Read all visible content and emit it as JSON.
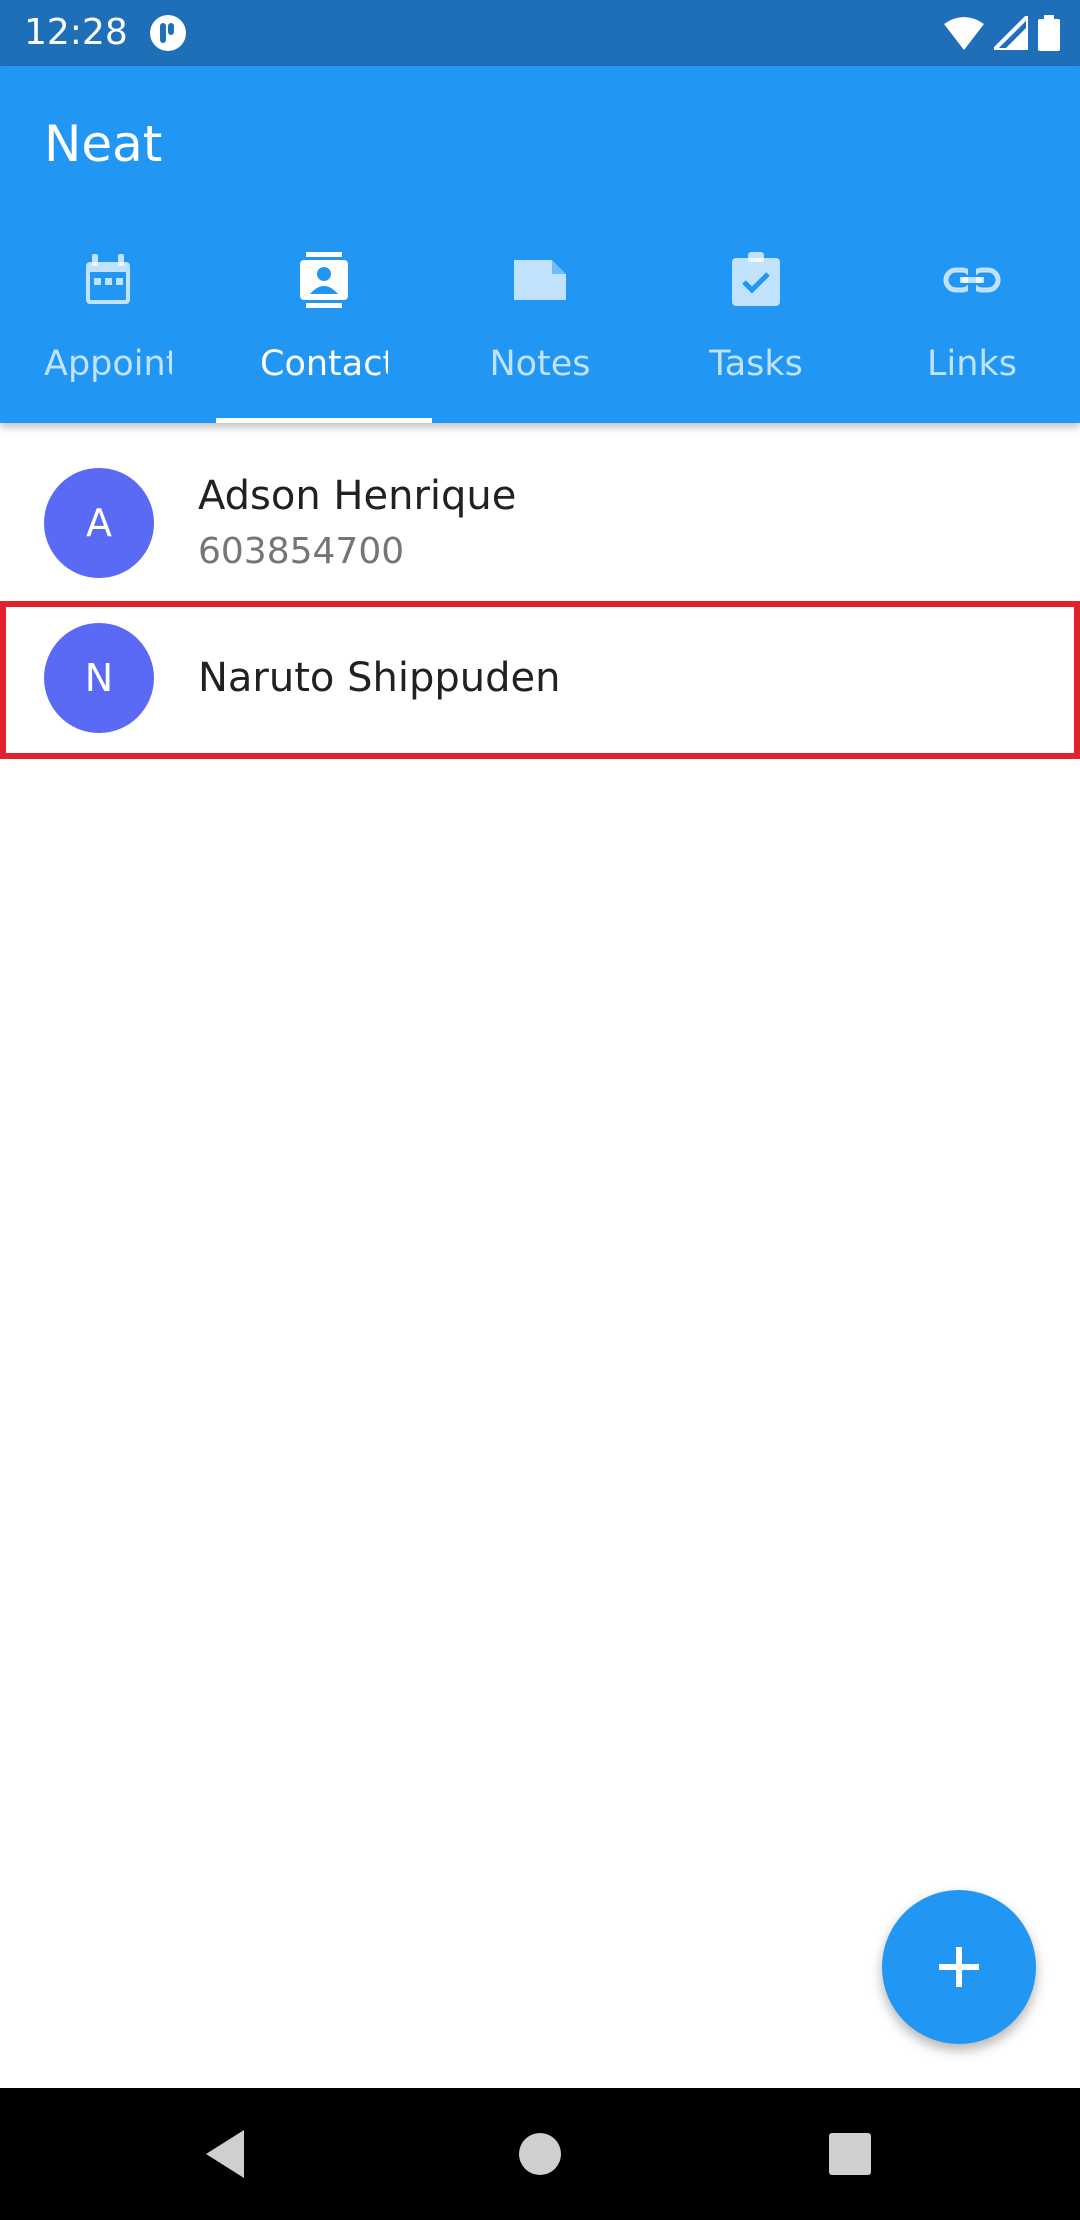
{
  "status_bar": {
    "time": "12:28",
    "icons": [
      "notification-app-icon",
      "wifi-icon",
      "signal-icon",
      "battery-icon"
    ]
  },
  "app_bar": {
    "title": "Neat",
    "tabs": [
      {
        "label": "Appointments",
        "icon": "calendar-icon",
        "active": false
      },
      {
        "label": "Contacts",
        "icon": "contact-icon",
        "active": true
      },
      {
        "label": "Notes",
        "icon": "note-icon",
        "active": false
      },
      {
        "label": "Tasks",
        "icon": "task-icon",
        "active": false
      },
      {
        "label": "Links",
        "icon": "link-icon",
        "active": false
      }
    ]
  },
  "contacts": [
    {
      "initial": "A",
      "name": "Adson Henrique",
      "phone": "603854700"
    },
    {
      "initial": "N",
      "name": "Naruto Shippuden",
      "phone": ""
    }
  ],
  "fab": {
    "icon": "plus-icon"
  },
  "nav_bar": {
    "buttons": [
      "back-icon",
      "home-icon",
      "recents-icon"
    ]
  },
  "colors": {
    "status_bar": "#1e6eb8",
    "primary": "#2196f3",
    "avatar": "#5b6af5",
    "highlight": "#e3212e"
  }
}
